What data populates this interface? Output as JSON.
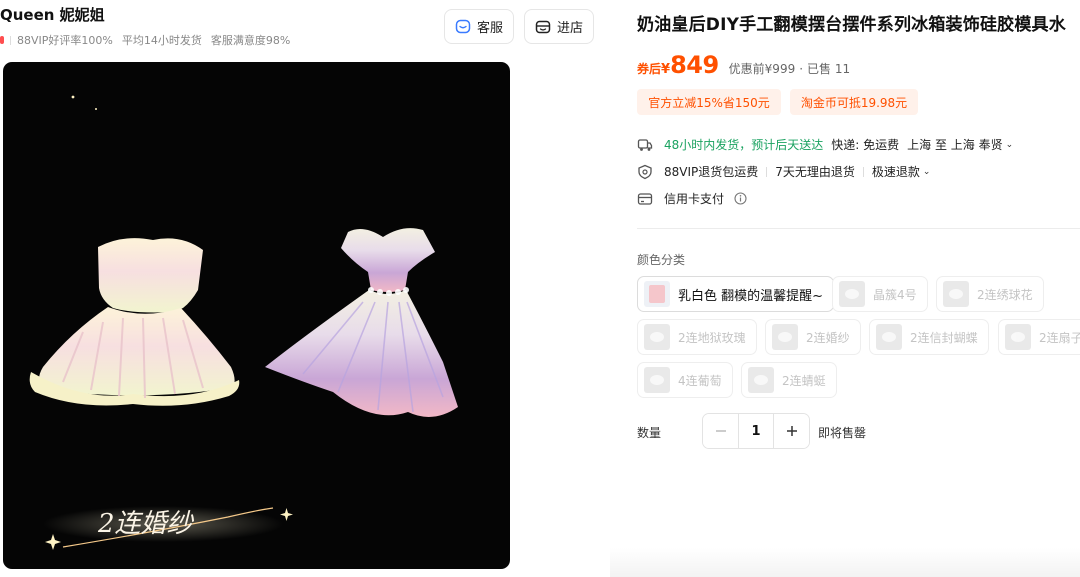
{
  "shop": {
    "name": "Queen 妮妮姐",
    "meta": [
      "88VIP好评率100%",
      "平均14小时发货",
      "客服满意度98%"
    ],
    "service_label": "客服",
    "store_label": "进店"
  },
  "product": {
    "title": "奶油皇后DIY手工翻模摆台摆件系列冰箱装饰硅胶模具水",
    "image_caption": "2连婚纱",
    "price_prefix": "券后",
    "currency": "¥",
    "price": "849",
    "original_price": "优惠前¥999",
    "separator": "·",
    "sold": "已售 11",
    "coupons": [
      "官方立减15%省150元",
      "淘金币可抵19.98元"
    ]
  },
  "shipping": {
    "green_text": "48小时内发货，预计后天送达",
    "express": "快递: 免运费",
    "route": "上海 至 上海 奉贤",
    "vip_return": "88VIP退货包运费",
    "no_reason_return": "7天无理由退货",
    "fast_refund": "极速退款",
    "credit_card": "信用卡支付"
  },
  "sku": {
    "label": "颜色分类",
    "options": [
      {
        "label": "乳白色 翻模的温馨提醒~",
        "state": "selected"
      },
      {
        "label": "晶簇4号",
        "state": "disabled"
      },
      {
        "label": "2连绣球花",
        "state": "disabled"
      },
      {
        "label": "2连地狱玫瑰",
        "state": "disabled"
      },
      {
        "label": "2连婚纱",
        "state": "disabled"
      },
      {
        "label": "2连信封蝴蝶",
        "state": "disabled"
      },
      {
        "label": "2连扇子",
        "state": "disabled"
      },
      {
        "label": "4连葡萄",
        "state": "disabled"
      },
      {
        "label": "2连蜻蜓",
        "state": "disabled"
      }
    ]
  },
  "quantity": {
    "label": "数量",
    "value": "1",
    "status": "即将售罄"
  },
  "colors": {
    "accent": "#ff5000",
    "coupon_bg": "#fff1ea",
    "green": "#1aa260"
  }
}
